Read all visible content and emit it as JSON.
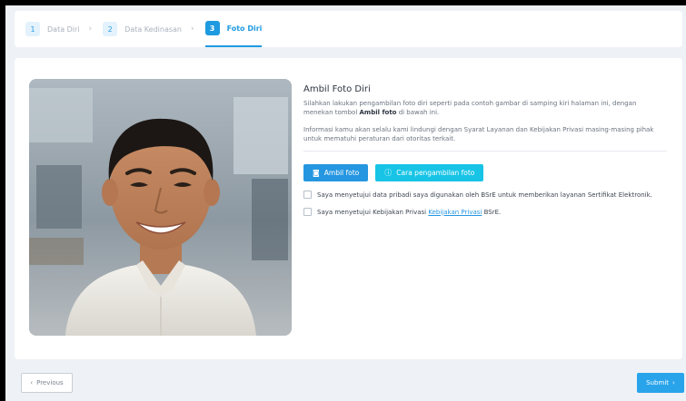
{
  "stepper": {
    "steps": [
      {
        "num": "1",
        "label": "Data Diri"
      },
      {
        "num": "2",
        "label": "Data Kedinasan"
      },
      {
        "num": "3",
        "label": "Foto Diri"
      }
    ],
    "active_step": 3
  },
  "photo_section": {
    "title": "Ambil Foto Diri",
    "instruction_pre": "Silahkan lakukan pengambilan foto diri seperti pada contoh gambar di samping kiri halaman ini, dengan menekan tombol ",
    "instruction_bold": "Ambil foto",
    "instruction_post": " di bawah ini.",
    "privacy_info": "Informasi kamu akan selalu kami lindungi dengan Syarat Layanan dan Kebijakan Privasi masing-masing pihak untuk mematuhi peraturan dari otoritas terkait.",
    "take_photo_label": "Ambil foto",
    "how_to_label": "Cara pengambilan foto",
    "consent_data_text": "Saya menyetujui data pribadi saya digunakan oleh BSrE untuk memberikan layanan Sertifikat Elektronik.",
    "consent_privacy_pre": "Saya menyetujui Kebijakan Privasi ",
    "consent_privacy_link": "Kebijakan Privasi",
    "consent_privacy_post": " BSrE."
  },
  "footer": {
    "previous_label": "Previous",
    "submit_label": "Submit"
  },
  "colors": {
    "primary": "#2596e0",
    "cyan": "#17c4e6",
    "background": "#eef1f6"
  }
}
